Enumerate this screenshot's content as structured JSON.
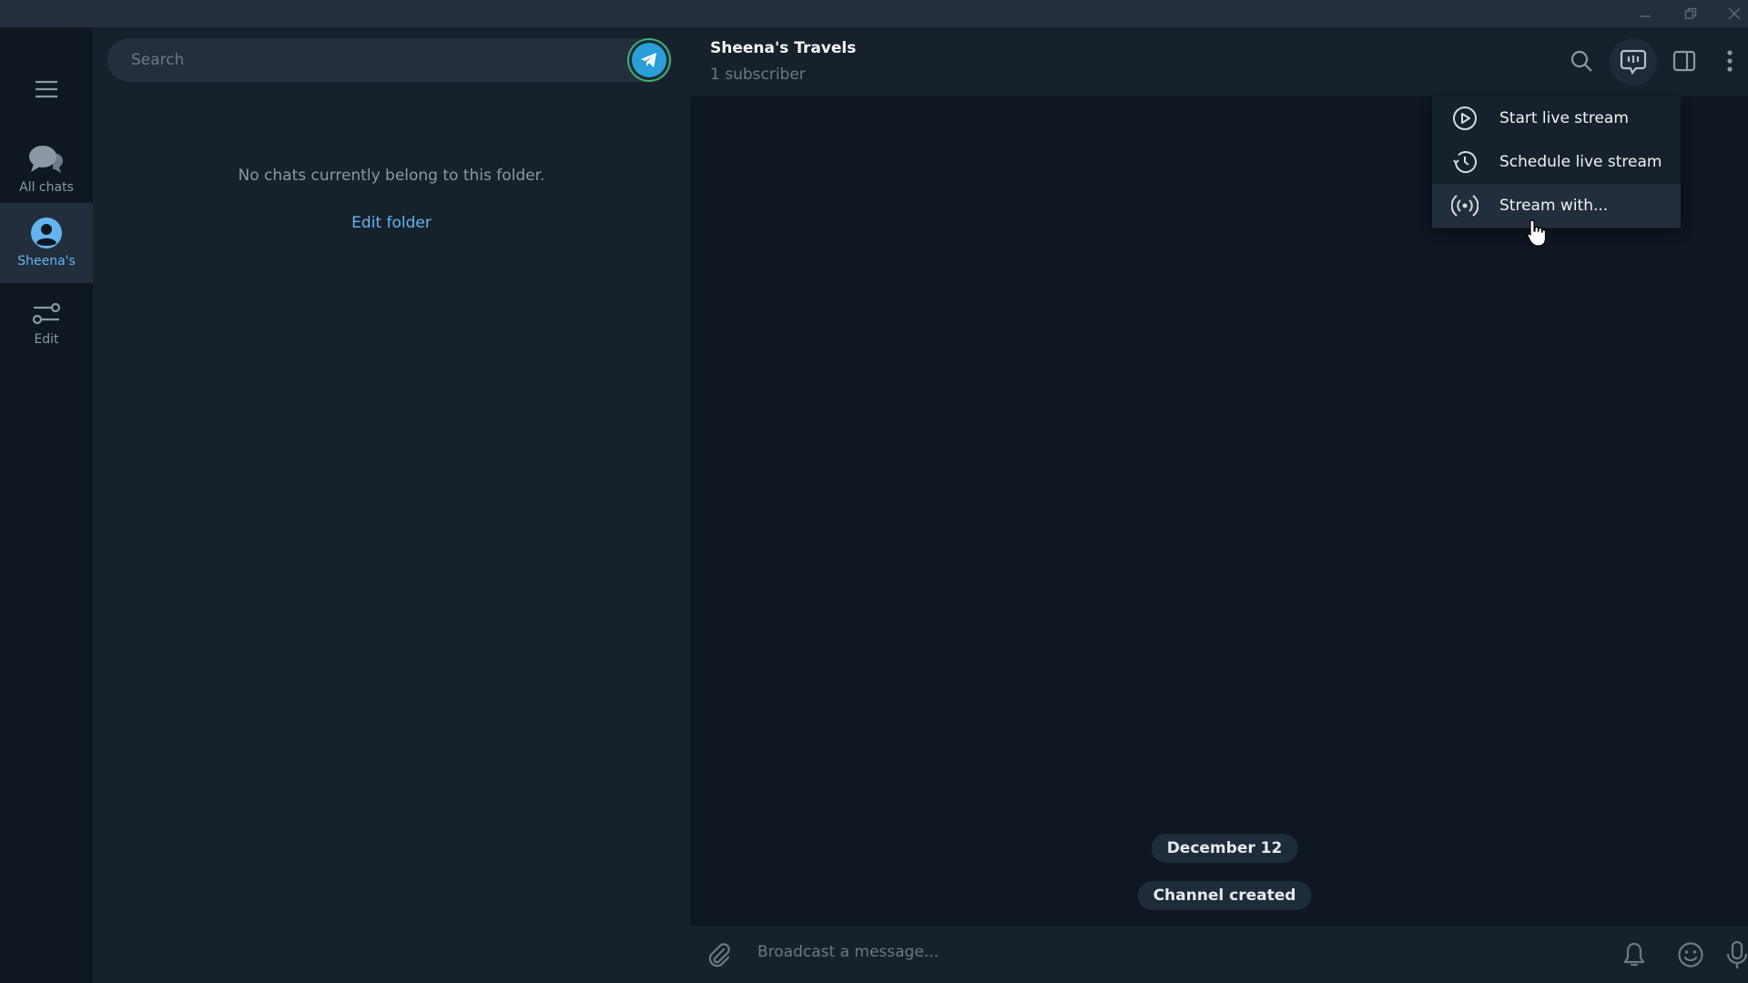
{
  "window": {
    "controls": {
      "minimize": "minimize-icon",
      "restore": "restore-icon",
      "close": "close-icon"
    }
  },
  "folders": {
    "menu_icon": "hamburger-menu-icon",
    "items": [
      {
        "label": "All chats",
        "icon": "chats-icon",
        "active": false
      },
      {
        "label": "Sheena's",
        "icon": "user-circle-icon",
        "active": true
      },
      {
        "label": "Edit",
        "icon": "sliders-icon",
        "active": false
      }
    ]
  },
  "chatlist": {
    "search_placeholder": "Search",
    "empty_message": "No chats currently belong to this folder.",
    "edit_folder_label": "Edit folder"
  },
  "chat": {
    "title": "Sheena's Travels",
    "subtitle": "1 subscriber",
    "header_icons": [
      "search-icon",
      "live-stream-icon",
      "sidebar-toggle-icon",
      "more-vertical-icon"
    ],
    "dropdown": [
      {
        "label": "Start live stream",
        "icon": "play-circle-icon"
      },
      {
        "label": "Schedule live stream",
        "icon": "history-clock-icon"
      },
      {
        "label": "Stream with...",
        "icon": "broadcast-icon",
        "hovered": true
      }
    ],
    "service_messages": {
      "date": "December 12",
      "event": "Channel created"
    },
    "composer": {
      "placeholder": "Broadcast a message...",
      "icons": [
        "attach-icon",
        "bell-icon",
        "emoji-icon",
        "microphone-icon"
      ]
    }
  },
  "colors": {
    "accent": "#64b5ef",
    "panel": "#17212b",
    "background": "#0e1621",
    "titlebar": "#242f3d"
  }
}
